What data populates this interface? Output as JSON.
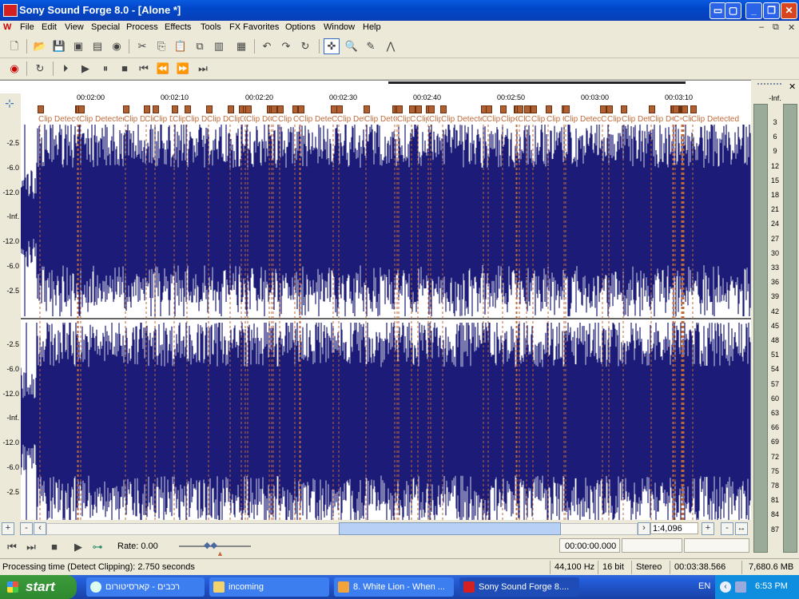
{
  "window": {
    "title": "Sony Sound Forge 8.0 - [Alone *]"
  },
  "menu": [
    "File",
    "Edit",
    "View",
    "Special",
    "Process",
    "Effects",
    "Tools",
    "FX Favorites",
    "Options",
    "Window",
    "Help"
  ],
  "ruler": {
    "ticks": [
      "00:02:00",
      "00:02:10",
      "00:02:20",
      "00:02:30",
      "00:02:40",
      "00:02:50",
      "00:03:00",
      "00:03:10"
    ]
  },
  "markers": {
    "label": "Clip Detected",
    "short": "Clip D",
    "count": 56
  },
  "scale_top": [
    "-2.5",
    "-6.0",
    "-12.0",
    "-Inf.",
    "-12.0",
    "-6.0",
    "-2.5"
  ],
  "scale_bottom": [
    "-2.5",
    "-6.0",
    "-12.0",
    "-Inf.",
    "-12.0",
    "-6.0",
    "-2.5"
  ],
  "meter": {
    "top_label": "-Inf.",
    "ticks": [
      "3",
      "6",
      "9",
      "12",
      "15",
      "18",
      "21",
      "24",
      "27",
      "30",
      "33",
      "36",
      "39",
      "42",
      "45",
      "48",
      "51",
      "54",
      "57",
      "60",
      "63",
      "66",
      "69",
      "72",
      "75",
      "78",
      "81",
      "84",
      "87"
    ]
  },
  "zoom": {
    "ratio": "1:4,096",
    "plus": "+",
    "minus": "-"
  },
  "transport": {
    "rate": "Rate: 0.00",
    "time": "00:00:00.000"
  },
  "status": {
    "message": "Processing time (Detect Clipping): 2.750 seconds",
    "sample_rate": "44,100 Hz",
    "bit_depth": "16 bit",
    "channels": "Stereo",
    "length": "00:03:38.566",
    "free": "7,680.6 MB"
  },
  "taskbar": {
    "start": "start",
    "tasks": [
      "רכבים - קארסיטורום",
      "incoming",
      "8. White Lion - When ...",
      "Sony Sound Forge 8...."
    ],
    "lang": "EN",
    "clock": "6:53 PM"
  },
  "colors": {
    "waveform": "#1c1c78",
    "marker": "#c06a3a",
    "accent": "#316ac5"
  }
}
